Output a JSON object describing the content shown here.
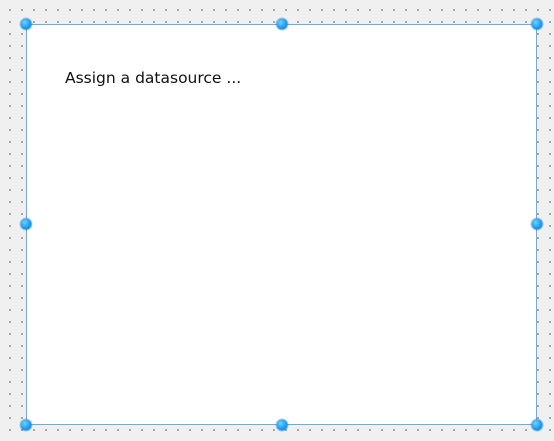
{
  "control": {
    "placeholder_text": "Assign a datasource ..."
  },
  "colors": {
    "canvas_background": "#f0f0f0",
    "grid_dot": "#8c8c8c",
    "control_background": "#ffffff",
    "control_border": "#7fa6cf",
    "handle": "#1e9cf0"
  }
}
